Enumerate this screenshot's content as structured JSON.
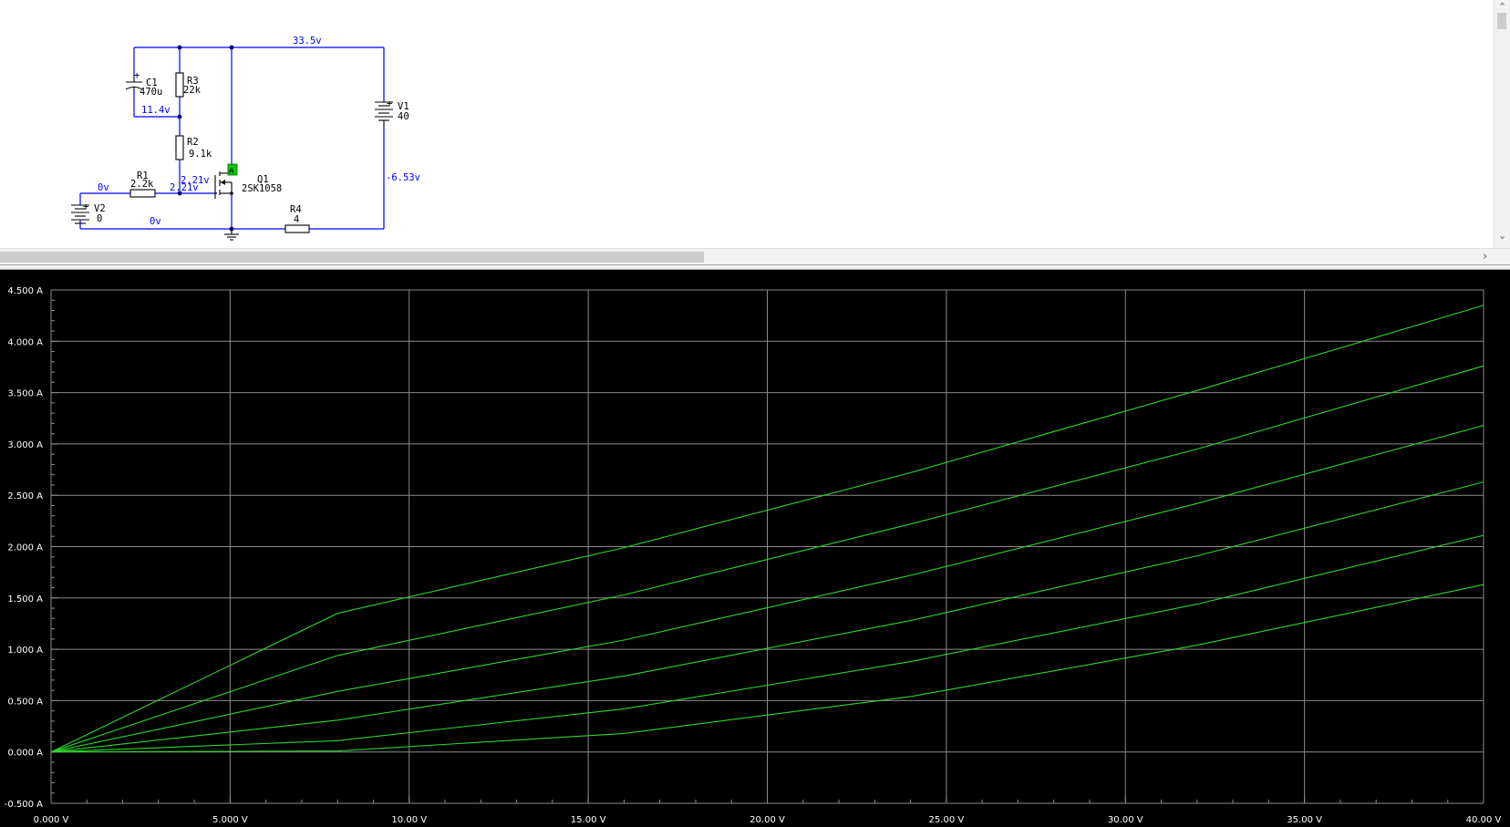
{
  "schematic": {
    "components": {
      "c1": {
        "name": "C1",
        "value": "470u"
      },
      "r3": {
        "name": "R3",
        "value": "22k"
      },
      "r2": {
        "name": "R2",
        "value": "9.1k"
      },
      "r1": {
        "name": "R1",
        "value": "2.2k"
      },
      "r4": {
        "name": "R4",
        "value": "4"
      },
      "v1": {
        "name": "V1",
        "value": "40"
      },
      "v2": {
        "name": "V2",
        "value": "0"
      },
      "q1": {
        "name": "Q1",
        "value": "2SK1058"
      },
      "probe": {
        "label": "A"
      }
    },
    "node_voltages": {
      "top": "33.5v",
      "mid": "11.4v",
      "gate_upper": "2.21v",
      "gate_lower": "2.21v",
      "v2_node": "0v",
      "ground": "0v",
      "v1_neg": "-6.53v"
    }
  },
  "scrollbars": {
    "up": "⌃",
    "down": "⌄",
    "right": "›"
  },
  "colors": {
    "trace": "#2dd52d",
    "grid": "#8a8a8a",
    "background": "#000000",
    "wire": "#0000ff"
  },
  "chart_data": {
    "type": "line",
    "x_tick_labels": [
      "0.000 V",
      "5.000 V",
      "10.00 V",
      "15.00 V",
      "20.00 V",
      "25.00 V",
      "30.00 V",
      "35.00 V",
      "40.00 V"
    ],
    "y_tick_labels": [
      "-0.500 A",
      "0.000 A",
      "0.500 A",
      "1.000 A",
      "1.500 A",
      "2.000 A",
      "2.500 A",
      "3.000 A",
      "3.500 A",
      "4.000 A",
      "4.500 A"
    ],
    "xlim": [
      0,
      40
    ],
    "ylim": [
      -0.5,
      4.5
    ],
    "grid": true,
    "series": [
      {
        "x": [
          0,
          8,
          16,
          24,
          32,
          40
        ],
        "y": [
          0,
          1.35,
          1.99,
          2.72,
          3.52,
          4.35
        ]
      },
      {
        "x": [
          0,
          8,
          16,
          24,
          32,
          40
        ],
        "y": [
          0,
          0.94,
          1.53,
          2.22,
          2.95,
          3.76
        ]
      },
      {
        "x": [
          0,
          8,
          16,
          24,
          32,
          40
        ],
        "y": [
          0,
          0.59,
          1.09,
          1.72,
          2.42,
          3.18
        ]
      },
      {
        "x": [
          0,
          8,
          16,
          24,
          32,
          40
        ],
        "y": [
          0,
          0.31,
          0.74,
          1.28,
          1.91,
          2.63
        ]
      },
      {
        "x": [
          0,
          8,
          16,
          24,
          32,
          40
        ],
        "y": [
          0,
          0.11,
          0.42,
          0.88,
          1.44,
          2.11
        ]
      },
      {
        "x": [
          0,
          8,
          16,
          24,
          32,
          40
        ],
        "y": [
          0,
          0.01,
          0.18,
          0.54,
          1.04,
          1.63
        ]
      }
    ]
  }
}
